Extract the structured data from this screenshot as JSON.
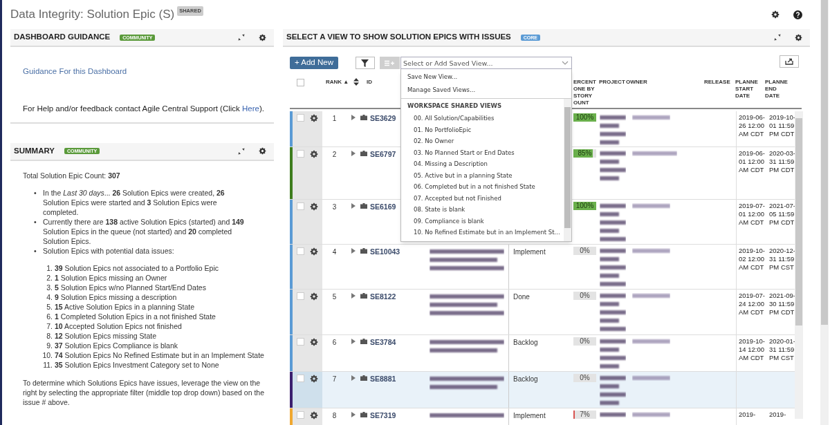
{
  "page": {
    "title": "Data Integrity: Solution Epic (S)",
    "badge": "SHARED"
  },
  "guidance_panel": {
    "title": "DASHBOARD GUIDANCE",
    "badge": "COMMUNITY",
    "link": "Guidance For this Dashboard",
    "help": {
      "before": "For Help and/or feedback contact Agile Central Support (Click ",
      "link": "Here",
      "after": ")."
    }
  },
  "summary_panel": {
    "title": "SUMMARY",
    "badge": "COMMUNITY",
    "total": "Total Solution Epic Count: **307**",
    "bullets": [
      {
        "marker": "•",
        "text": "In the *Last 30 days*... **26** Solution Epics were created, **26** Solution Epics were started and **3** Solution Epics were completed."
      },
      {
        "marker": "•",
        "text": "Currently there are **138** active Solution Epics (started) and **149** Solution Epics in the queue (not started) and **20** completed Solution Epics."
      },
      {
        "marker": "•",
        "text": "Solution Epics with potential data issues:"
      }
    ],
    "issues": [
      {
        "number": "1.",
        "text": "**39** Solution Epics not associated to a Portfolio Epic"
      },
      {
        "number": "2.",
        "text": "**1** Solution Epics missing an Owner"
      },
      {
        "number": "3.",
        "text": "**5** Solution Epics w/no Planned Start/End Dates"
      },
      {
        "number": "4.",
        "text": "**9** Solution Epics missing a description"
      },
      {
        "number": "5.",
        "text": "**15** Active Solution Epics in a planning State"
      },
      {
        "number": "6.",
        "text": "**1** Completed Solution Epics in a not finished State"
      },
      {
        "number": "7.",
        "text": "**10** Accepted Solution Epics not finished"
      },
      {
        "number": "8.",
        "text": "**12** Solution Epics missing State"
      },
      {
        "number": "9.",
        "text": "**37** Solution Epics Compliance is blank"
      },
      {
        "number": "10.",
        "text": "**74** Solution Epics No Refined Estimate but in an Implement State"
      },
      {
        "number": "11.",
        "text": "**35** Solution Epics Investment Category set to None"
      }
    ],
    "footer": "To determine which Solutions Epics have issues, leverage the view on the right by selecting the appropriate filter (middle top drop down) based on the issue # above."
  },
  "view_panel": {
    "title": "SELECT A VIEW TO SHOW SOLUTION EPICS WITH ISSUES",
    "badge": "CORE",
    "add_button": "+ Add New",
    "view_select": {
      "placeholder": "Select or Add Saved View...",
      "expanded": true,
      "actions": [
        "Save New View...",
        "Manage Saved Views..."
      ],
      "group": "WORKSPACE SHARED VIEWS",
      "options": [
        "00. All Solution/Capabilities",
        "01. No PortfolioEpic",
        "02. No Owner",
        "03. No Planned Start or End Dates",
        "04. Missing a Description",
        "05. Active but in a planning State",
        "06. Completed but in a not finished State",
        "07. Accepted but not Finished",
        "08. State is blank",
        "09. Compliance is blank",
        "10. No Refined Estimate but in an Implement St..."
      ]
    },
    "table": {
      "all_checked": false,
      "columns": [
        {
          "kind": "rank",
          "label": "RANK ▲"
        },
        {
          "kind": "id",
          "label": "ID"
        },
        {
          "kind": "percent",
          "label": "ERCENT ONE BY STORY OUNT"
        },
        {
          "kind": "project",
          "label": "PROJECT"
        },
        {
          "kind": "owner",
          "label": "OWNER"
        },
        {
          "kind": "release",
          "label": "RELEASE"
        },
        {
          "kind": "start",
          "label": "PLANNE START DATE"
        },
        {
          "kind": "end",
          "label": "PLANNE END DATE"
        }
      ],
      "rows": [
        {
          "rank": "1",
          "id": "SE3629",
          "percent": "100%",
          "level": 1,
          "color": "#5b9bd5",
          "selected": false,
          "start": "2019-06-26 12:00 AM CDT",
          "end": "2019-10-01 11:59 PM CDT"
        },
        {
          "rank": "2",
          "id": "SE6797",
          "percent": "85%",
          "level": 0.85,
          "color": "#3e7d1e",
          "selected": false,
          "start": "2019-06-01 12:00 AM CDT",
          "end": "2020-03-31 11:59 PM CDT"
        },
        {
          "rank": "3",
          "id": "SE6169",
          "percent": "100%",
          "level": 1,
          "color": "#5b9bd5",
          "selected": false,
          "start": "2019-07-01 12:00 AM CDT",
          "end": "2021-07-05 11:59 PM CDT"
        },
        {
          "rank": "4",
          "id": "SE10043",
          "state": "Implement",
          "percent": "0%",
          "level": 0,
          "color": "#5b9bd5",
          "selected": false,
          "start": "2019-10-02 12:00 AM CDT",
          "end": "2020-12-31 11:59 PM CST"
        },
        {
          "rank": "5",
          "id": "SE8122",
          "state": "Done",
          "percent": "0%",
          "level": 0,
          "color": "#5b9bd5",
          "selected": false,
          "start": "2019-07-24 12:00 AM CDT",
          "end": "2021-09-30 11:59 PM CDT"
        },
        {
          "rank": "6",
          "id": "SE3784",
          "state": "Backlog",
          "percent": "0%",
          "level": 0,
          "color": "#5b9bd5",
          "selected": false,
          "start": "2019-10-14 12:00 AM CDT",
          "end": "2020-01-31 11:59 PM CST"
        },
        {
          "rank": "7",
          "id": "SE8881",
          "state": "Backlog",
          "percent": "0%",
          "level": 0,
          "color": "#3b1f6e",
          "selected": true
        },
        {
          "rank": "8",
          "id": "SE7319",
          "state": "Implement",
          "percent": "7%",
          "level": 0.07,
          "color": "#f0a830",
          "selected": false,
          "start": "2019-",
          "end": "2019-"
        }
      ]
    }
  }
}
